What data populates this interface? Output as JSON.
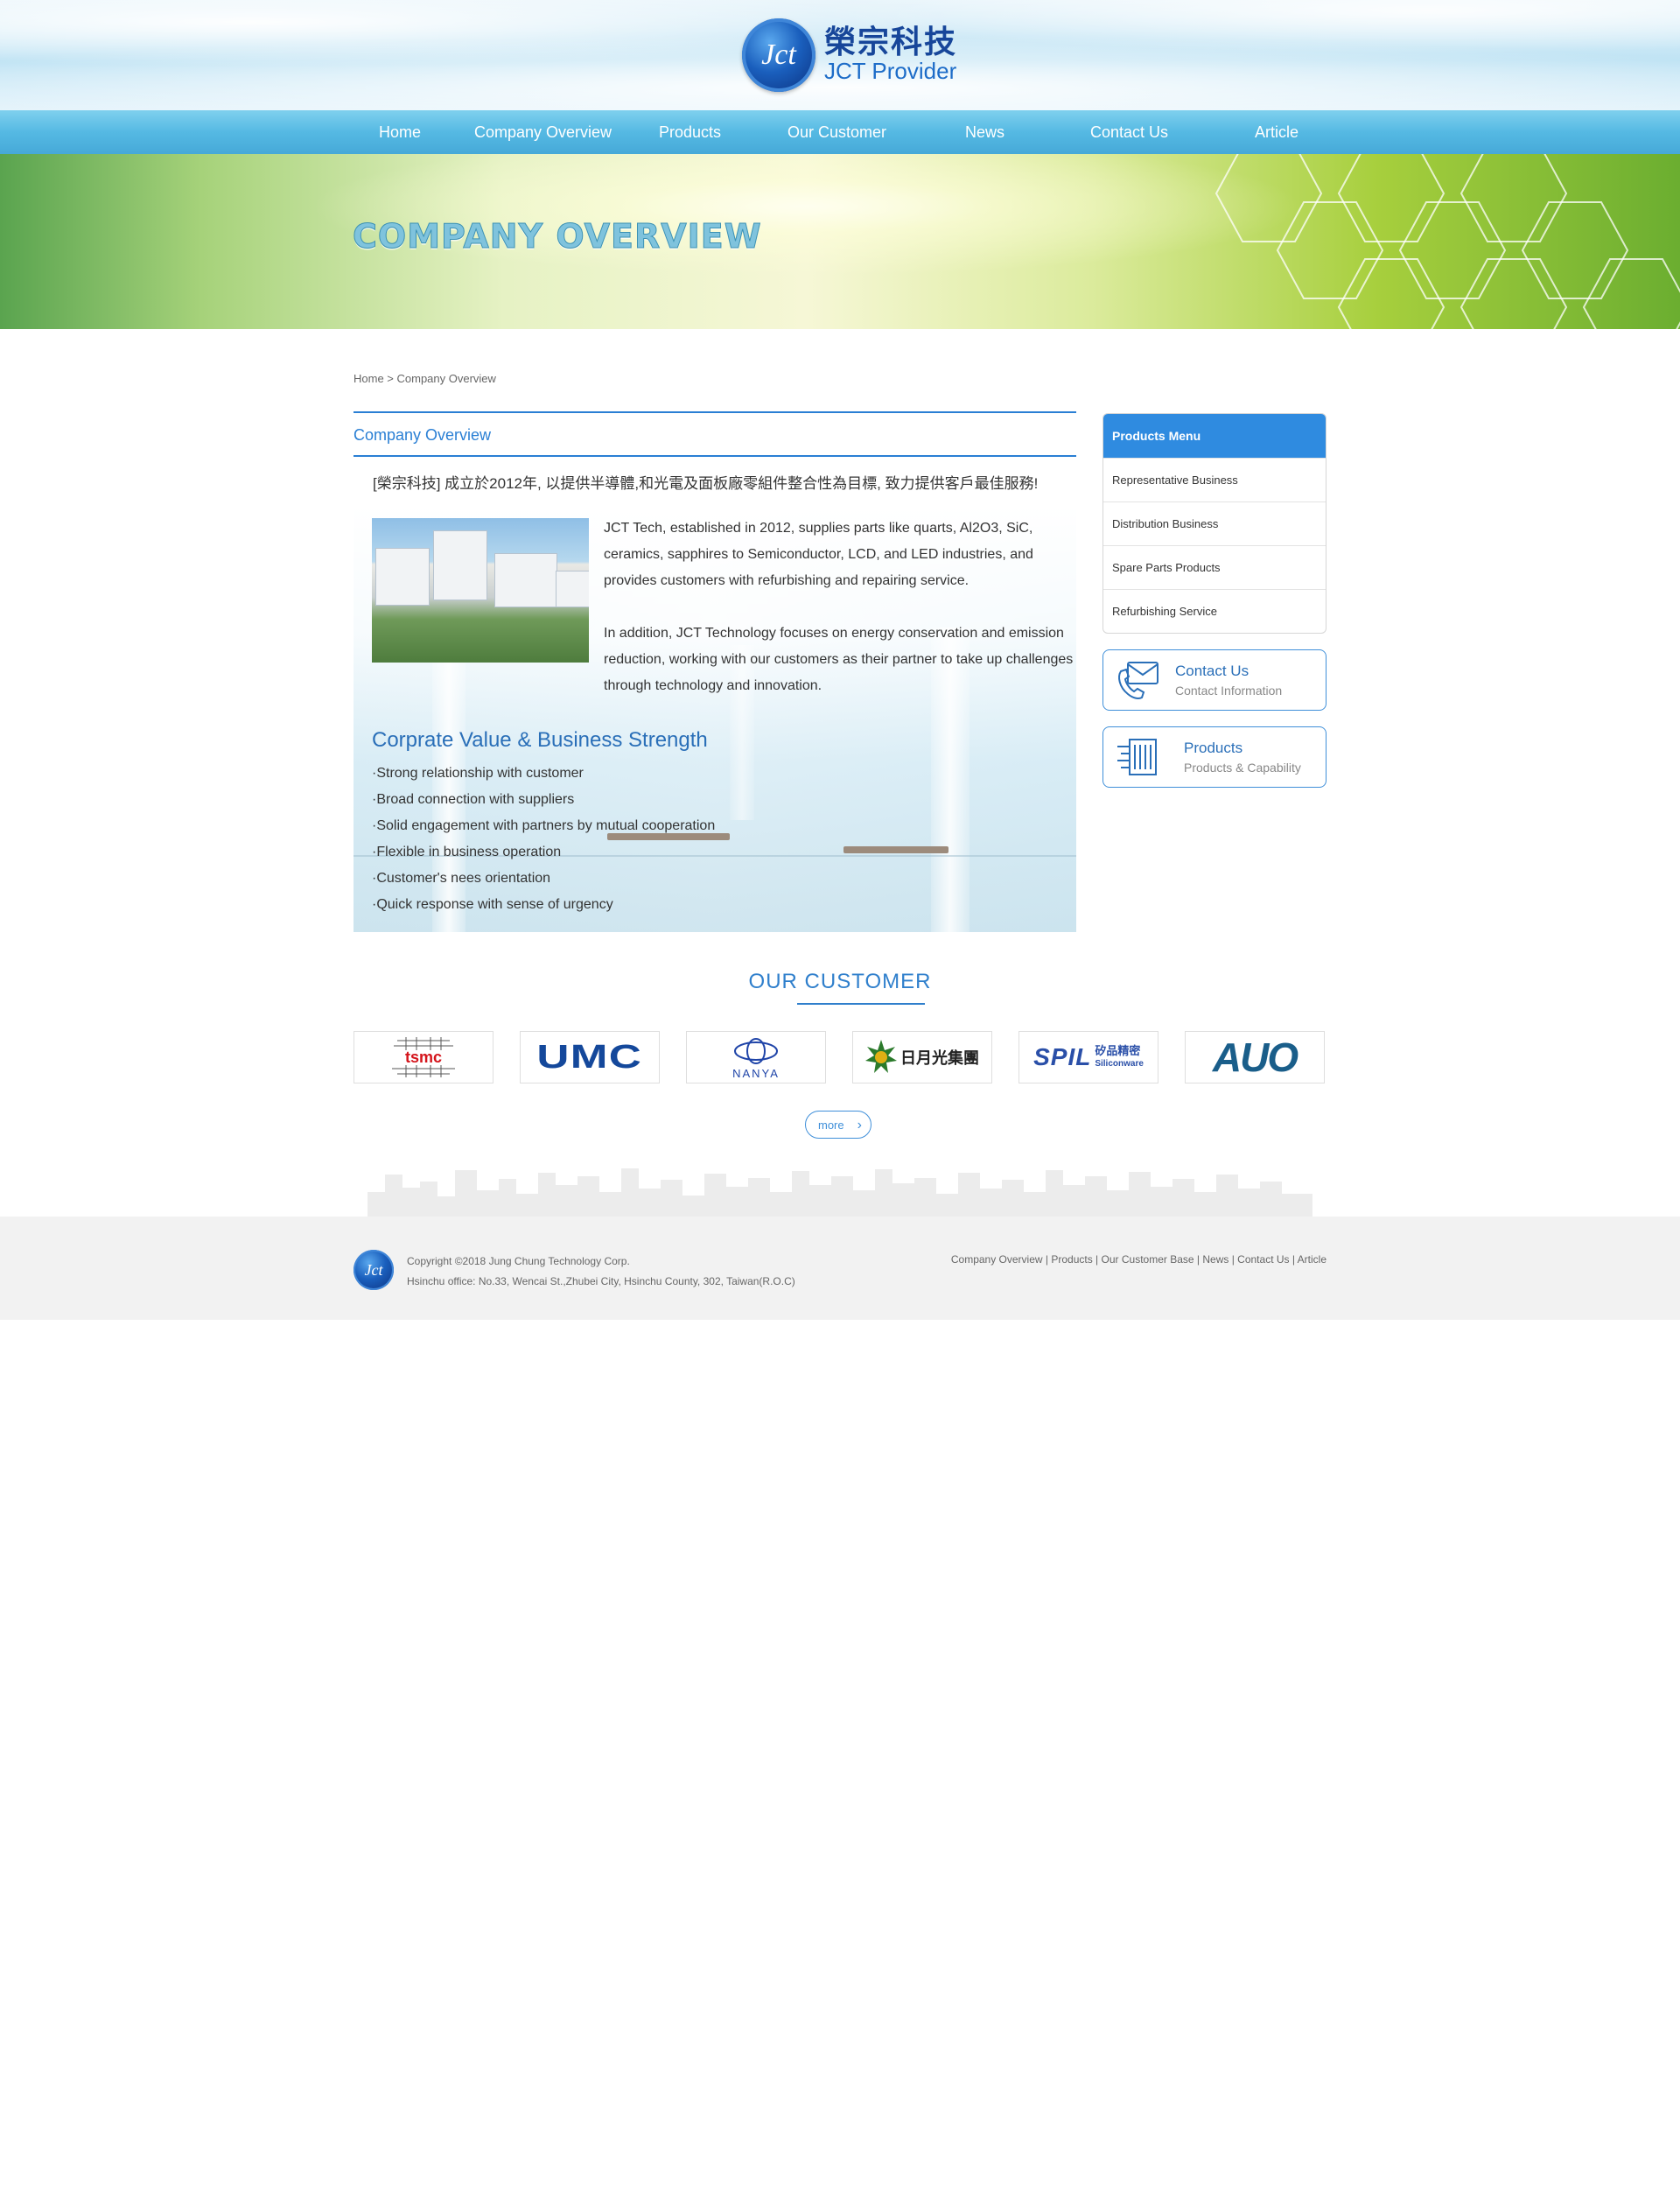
{
  "logo": {
    "badge": "Jct",
    "cn": "榮宗科技",
    "en": "JCT Provider"
  },
  "nav": [
    {
      "label": "Home"
    },
    {
      "label": "Company Overview"
    },
    {
      "label": "Products"
    },
    {
      "label": "Our Customer"
    },
    {
      "label": "News"
    },
    {
      "label": "Contact Us"
    },
    {
      "label": "Article"
    }
  ],
  "banner": {
    "title": "COMPANY OVERVIEW"
  },
  "breadcrumb": "Home > Company Overview",
  "main": {
    "section_title": "Company Overview",
    "intro_cn": "[榮宗科技] 成立於2012年, 以提供半導體,和光電及面板廠零組件整合性為目標, 致力提供客戶最佳服務!",
    "paragraph1": "JCT Tech, established in 2012, supplies parts like quarts, Al2O3, SiC, ceramics, sapphires to Semiconductor, LCD, and LED industries, and provides customers with refurbishing and repairing service.",
    "paragraph2": "In addition, JCT Technology focuses on energy conservation and emission reduction, working with our customers as their partner to take up challenges through technology and innovation.",
    "values_title": "Corprate Value & Business Strength",
    "values": [
      "·Strong relationship with customer",
      "·Broad connection with suppliers",
      "·Solid engagement with partners by mutual cooperation",
      "·Flexible in business operation",
      "·Customer's nees orientation",
      "·Quick response with sense of urgency"
    ]
  },
  "sidebar": {
    "menu_title": "Products Menu",
    "menu_items": [
      "Representative Business",
      "Distribution Business",
      "Spare Parts Products",
      "Refurbishing Service"
    ],
    "contact_box": {
      "title": "Contact Us",
      "subtitle": "Contact Information",
      "icon": "envelope-phone-icon"
    },
    "products_box": {
      "title": "Products",
      "subtitle": "Products & Capability",
      "icon": "circuit-board-icon"
    }
  },
  "customers": {
    "title": "OUR CUSTOMER",
    "logos": [
      "tsmc",
      "UMC",
      "NANYA",
      "日月光集團",
      "SPIL Siliconware",
      "AUO"
    ],
    "spil_cn": "矽品精密",
    "more_label": "more"
  },
  "footer": {
    "badge": "Jct",
    "copyright": "Copyright ©2018 Jung Chung Technology Corp.",
    "address": "Hsinchu office: No.33, Wencai St.,Zhubei City, Hsinchu County, 302, Taiwan(R.O.C)",
    "links": [
      "Company Overview",
      "Products",
      "Our Customer Base",
      "News",
      "Contact Us",
      "Article"
    ],
    "separator": " | "
  },
  "colors": {
    "accent": "#2a7fd4",
    "nav": "#55b9e3",
    "footer_bg": "#f2f2f2",
    "sidebar_head": "#2f8be0"
  }
}
